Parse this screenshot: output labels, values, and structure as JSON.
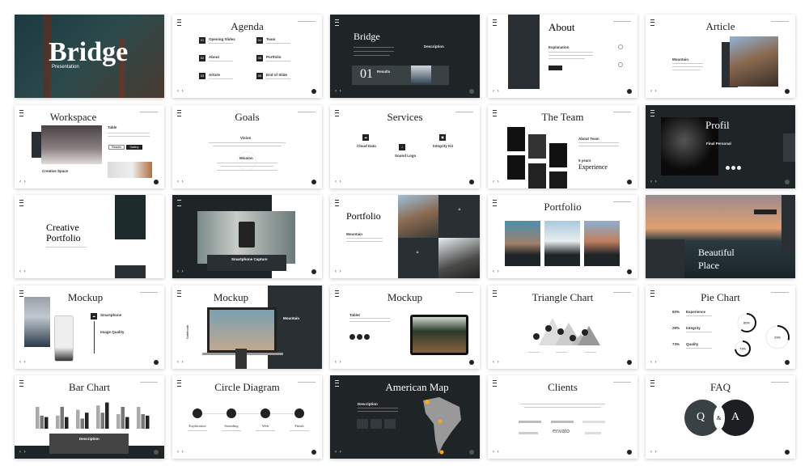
{
  "colors": {
    "dark": "#1f2427",
    "accent": "#f5a623",
    "light": "#ffffff"
  },
  "slides": {
    "cover": {
      "title": "Bridge",
      "subtitle": "Presentation"
    },
    "agenda": {
      "title": "Agenda",
      "items": [
        {
          "num": "01",
          "label": "Opening Slides"
        },
        {
          "num": "02",
          "label": "About"
        },
        {
          "num": "03",
          "label": "Article"
        },
        {
          "num": "04",
          "label": "Team"
        },
        {
          "num": "05",
          "label": "Portfolio"
        },
        {
          "num": "06",
          "label": "End of Slide"
        }
      ]
    },
    "bridge": {
      "title": "Bridge",
      "description": "Description",
      "number": "01",
      "results": "Results"
    },
    "about": {
      "title": "About",
      "heading": "Explanation"
    },
    "article": {
      "title": "Article",
      "heading": "Mountain"
    },
    "workspace": {
      "title": "Workspace",
      "heading": "Table",
      "caption": "Creative Space",
      "btn1": "Results",
      "btn2": "Gallery"
    },
    "goals": {
      "title": "Goals",
      "vision": "Vision",
      "mission": "Mission"
    },
    "services": {
      "title": "Services",
      "items": [
        "Cloud Data",
        "Sound Logo",
        "Integrity Kit"
      ]
    },
    "team": {
      "title": "The Team",
      "about": "About Team",
      "years": "5 years",
      "experience": "Experience"
    },
    "profil": {
      "title": "Profil",
      "heading": "Final Personal"
    },
    "creative": {
      "title_line1": "Creative",
      "title_line2": "Portfolio"
    },
    "smartphone": {
      "caption": "Smartphone Capture"
    },
    "portfolio1": {
      "title": "Portfolio",
      "heading": "Mountain"
    },
    "portfolio2": {
      "title": "Portfolio"
    },
    "beautiful": {
      "title_line1": "Beautiful",
      "title_line2": "Place"
    },
    "mockup1": {
      "title": "Mockup",
      "item1": "Smartphone",
      "item2": "Image Quality"
    },
    "mockup2": {
      "title": "Mockup",
      "side": "Notebook",
      "heading": "Mountain"
    },
    "mockup3": {
      "title": "Mockup",
      "heading": "Tablet"
    },
    "triangle": {
      "title": "Triangle Chart"
    },
    "pie": {
      "title": "Pie Chart",
      "items": [
        {
          "pct": "60%",
          "label": "Experience"
        },
        {
          "pct": "29%",
          "label": "Integrity"
        },
        {
          "pct": "73%",
          "label": "Quality"
        }
      ]
    },
    "barchart": {
      "title": "Bar Chart",
      "description": "Description"
    },
    "circle": {
      "title": "Circle Diagram",
      "steps": [
        "Exploration",
        "Sounding",
        "Web",
        "Finish"
      ]
    },
    "map": {
      "title": "American Map",
      "description": "Description"
    },
    "clients": {
      "title": "Clients",
      "logo": "envato"
    },
    "faq": {
      "title": "FAQ",
      "q": "Q",
      "amp": "&",
      "a": "A"
    }
  },
  "chart_data": [
    {
      "type": "bar",
      "title": "Bar Chart",
      "categories": [
        "1",
        "2",
        "3",
        "4",
        "5",
        "6"
      ],
      "series": [
        {
          "values": [
            75,
            45,
            65,
            80,
            50,
            75
          ],
          "color": "#aaaaaa"
        },
        {
          "values": [
            45,
            75,
            35,
            55,
            75,
            50
          ],
          "color": "#777777"
        },
        {
          "values": [
            40,
            40,
            55,
            90,
            40,
            45
          ],
          "color": "#222222"
        }
      ],
      "ylim": [
        0,
        100
      ]
    },
    {
      "type": "pie",
      "title": "Pie Chart",
      "categories": [
        "Experience",
        "Integrity",
        "Quality"
      ],
      "values": [
        60,
        29,
        73
      ]
    }
  ]
}
